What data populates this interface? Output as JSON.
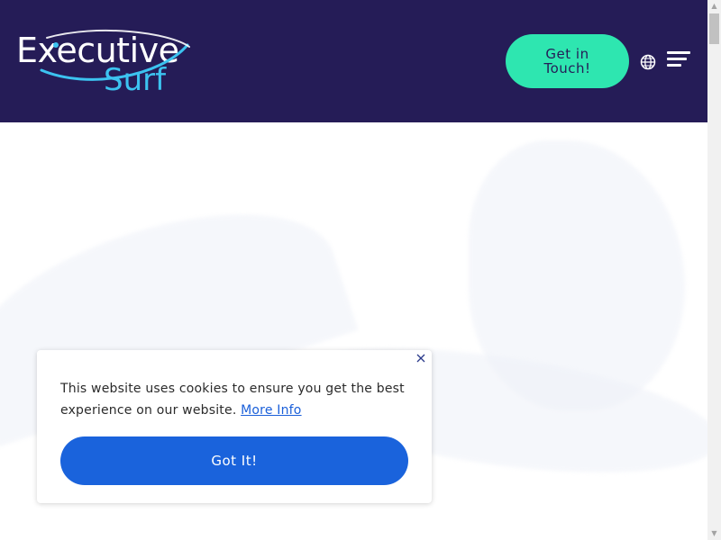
{
  "header": {
    "logo": {
      "line1": "Executive",
      "line2": "Surf"
    },
    "cta_label": "Get in Touch!",
    "language_icon": "globe-icon",
    "menu_icon": "hamburger-menu-icon"
  },
  "cookie_banner": {
    "message": "This website uses cookies to ensure you get the best experience on our website.",
    "link_label": "More Info",
    "accept_label": "Got It!",
    "close_icon": "close-icon"
  },
  "colors": {
    "header_bg": "#251c57",
    "cta_bg": "#2ee6b0",
    "accent_blue": "#1a63dc",
    "logo_accent": "#3cc3f0"
  }
}
